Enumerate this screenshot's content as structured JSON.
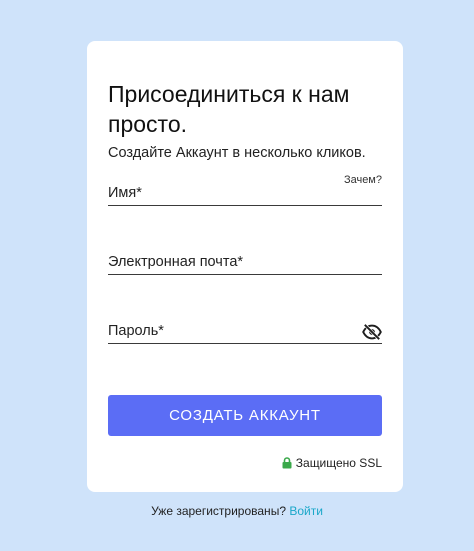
{
  "card": {
    "title": "Присоединиться к нам просто.",
    "subtitle": "Создайте Аккаунт в несколько кликов."
  },
  "form": {
    "name_label": "Имя*",
    "name_hint": "Зачем?",
    "email_label": "Электронная почта*",
    "password_label": "Пароль*",
    "submit_label": "СОЗДАТЬ АККАУНТ",
    "ssl_label": "Защищено SSL"
  },
  "footer": {
    "question": "Уже зарегистрированы?",
    "login_link": "Войти"
  },
  "colors": {
    "background": "#cfe3fa",
    "accent": "#5b6df5",
    "lock": "#3aa84a",
    "link": "#1aa7c9"
  },
  "icons": {
    "password_toggle": "eye-slash-icon",
    "ssl": "lock-icon"
  }
}
